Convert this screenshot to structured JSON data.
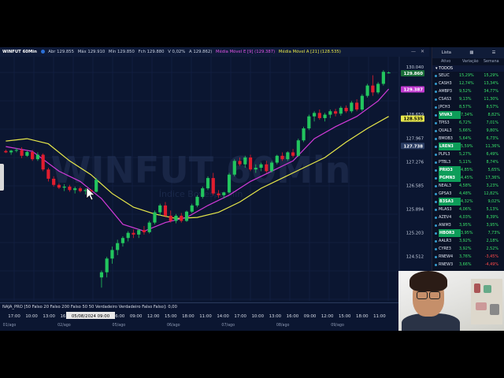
{
  "title_bar": {
    "symbol": "WINFUT 60Min",
    "abr": "Abr 129.855",
    "max": "Máx 129.910",
    "min": "Mín 129.850",
    "fech": "Fch 129.880",
    "var": "V 0,02%",
    "last": "A 129.862)",
    "ma9": "Média Móvel E [9] (129.387)",
    "ma21": "Média Móvel A [21] (128.535)"
  },
  "watermark": {
    "main": "WINFUT 60Min",
    "sub": "Índice Bovespa Min"
  },
  "indicator_bar": "NAJA_PRO [50 Falso 20 Falso 200 Falso 50 50 Verdadeiro Verdadeiro Falso Falso]: 0,00",
  "price_axis": {
    "labels": [
      "130.040",
      "128.659",
      "127.967",
      "127.276",
      "126.585",
      "125.894",
      "125.203",
      "124.512"
    ],
    "badges": [
      {
        "text": "129.860",
        "color": "#ffffff",
        "bg": "#1b6f3a"
      },
      {
        "text": "129.387",
        "color": "#ffffff",
        "bg": "#c13ad1"
      },
      {
        "text": "128.535",
        "color": "#000000",
        "bg": "#e6e64c"
      },
      {
        "text": "127.738",
        "color": "#ffffff",
        "bg": "#2b3d63"
      }
    ]
  },
  "time_axis": {
    "times": [
      "17:00",
      "10:00",
      "13:00",
      "16:00",
      "10:00",
      "13:00",
      "16:00",
      "09:00",
      "12:00",
      "15:00",
      "18:00",
      "11:00",
      "14:00",
      "17:00",
      "10:00",
      "13:00",
      "16:00",
      "09:00",
      "12:00",
      "15:00",
      "18:00",
      "11:00"
    ],
    "dates": [
      "01/ago",
      "02/ago",
      "05/ago",
      "06/ago",
      "07/ago",
      "08/ago",
      "09/ago"
    ],
    "cursor_label": "05/08/2024 09:00"
  },
  "watchlist": {
    "tabs": [
      "Lista",
      "Ativo",
      "Variação",
      "Semana"
    ],
    "group": "TODOS",
    "rows": [
      {
        "sym": "SELIC",
        "pct": "15,29%",
        "wk": "15,29%",
        "hl": false,
        "neg": false
      },
      {
        "sym": "CASH3",
        "pct": "12,74%",
        "wk": "13,34%",
        "hl": false,
        "neg": false
      },
      {
        "sym": "AMBP3",
        "pct": "9,52%",
        "wk": "34,77%",
        "hl": false,
        "neg": false
      },
      {
        "sym": "CSAS3",
        "pct": "9,13%",
        "wk": "11,30%",
        "hl": false,
        "neg": false
      },
      {
        "sym": "JPCH3",
        "pct": "8,57%",
        "wk": "8,57%",
        "hl": false,
        "neg": false
      },
      {
        "sym": "VIVA3",
        "pct": "7,34%",
        "wk": "8,82%",
        "hl": true,
        "neg": false
      },
      {
        "sym": "TPIS3",
        "pct": "6,72%",
        "wk": "7,01%",
        "hl": false,
        "neg": false
      },
      {
        "sym": "QUAL3",
        "pct": "5,66%",
        "wk": "9,80%",
        "hl": false,
        "neg": false
      },
      {
        "sym": "BMOB3",
        "pct": "5,64%",
        "wk": "6,73%",
        "hl": false,
        "neg": false
      },
      {
        "sym": "LREN3",
        "pct": "5,59%",
        "wk": "11,36%",
        "hl": true,
        "neg": false
      },
      {
        "sym": "PLPL3",
        "pct": "5,27%",
        "wk": "6,49%",
        "hl": false,
        "neg": false
      },
      {
        "sym": "PTBL3",
        "pct": "5,11%",
        "wk": "8,74%",
        "hl": false,
        "neg": false
      },
      {
        "sym": "PRIO3",
        "pct": "4,85%",
        "wk": "5,65%",
        "hl": true,
        "neg": false
      },
      {
        "sym": "PGMN3",
        "pct": "4,45%",
        "wk": "17,36%",
        "hl": true,
        "neg": false
      },
      {
        "sym": "NEAL3",
        "pct": "4,58%",
        "wk": "3,23%",
        "hl": false,
        "neg": false
      },
      {
        "sym": "GPSA3",
        "pct": "4,48%",
        "wk": "12,82%",
        "hl": false,
        "neg": false
      },
      {
        "sym": "B3SA3",
        "pct": "4,32%",
        "wk": "9,02%",
        "hl": true,
        "neg": false
      },
      {
        "sym": "MLAS3",
        "pct": "4,06%",
        "wk": "5,13%",
        "hl": false,
        "neg": false
      },
      {
        "sym": "AZEV4",
        "pct": "4,03%",
        "wk": "8,39%",
        "hl": false,
        "neg": false
      },
      {
        "sym": "ANIM3",
        "pct": "3,95%",
        "wk": "3,95%",
        "hl": false,
        "neg": false
      },
      {
        "sym": "HBOR3",
        "pct": "3,95%",
        "wk": "7,73%",
        "hl": true,
        "neg": false
      },
      {
        "sym": "AALR3",
        "pct": "3,92%",
        "wk": "2,18%",
        "hl": false,
        "neg": false
      },
      {
        "sym": "CYRE3",
        "pct": "3,92%",
        "wk": "2,52%",
        "hl": false,
        "neg": false
      },
      {
        "sym": "RNEW4",
        "pct": "3,76%",
        "wk": "-3,45%",
        "hl": false,
        "neg": true
      },
      {
        "sym": "RNEW3",
        "pct": "3,66%",
        "wk": "-4,49%",
        "hl": false,
        "neg": true
      }
    ]
  },
  "colors": {
    "up": "#22c55e",
    "down": "#e11d2e",
    "ma9": "#d13ad8",
    "ma21": "#e8e84a",
    "background": "#0b1631"
  },
  "chart_data": {
    "type": "candlestick",
    "candles": [
      {
        "o": 127.59,
        "h": 127.63,
        "l": 127.53,
        "c": 127.55
      },
      {
        "o": 127.55,
        "h": 127.62,
        "l": 127.48,
        "c": 127.6
      },
      {
        "o": 127.6,
        "h": 127.68,
        "l": 127.55,
        "c": 127.62
      },
      {
        "o": 127.62,
        "h": 127.7,
        "l": 127.38,
        "c": 127.45
      },
      {
        "o": 127.45,
        "h": 127.6,
        "l": 127.42,
        "c": 127.56
      },
      {
        "o": 127.56,
        "h": 127.62,
        "l": 127.3,
        "c": 127.35
      },
      {
        "o": 127.35,
        "h": 127.55,
        "l": 127.3,
        "c": 127.48
      },
      {
        "o": 127.48,
        "h": 127.52,
        "l": 127.0,
        "c": 127.05
      },
      {
        "o": 127.05,
        "h": 127.1,
        "l": 126.7,
        "c": 126.78
      },
      {
        "o": 126.78,
        "h": 126.85,
        "l": 126.55,
        "c": 126.6
      },
      {
        "o": 126.6,
        "h": 126.65,
        "l": 126.48,
        "c": 126.52
      },
      {
        "o": 126.52,
        "h": 126.62,
        "l": 126.42,
        "c": 126.55
      },
      {
        "o": 126.55,
        "h": 126.6,
        "l": 126.4,
        "c": 126.45
      },
      {
        "o": 126.45,
        "h": 126.55,
        "l": 126.35,
        "c": 126.5
      },
      {
        "o": 126.5,
        "h": 126.55,
        "l": 126.38,
        "c": 126.42
      },
      {
        "o": 126.42,
        "h": 126.5,
        "l": 126.32,
        "c": 126.45
      },
      {
        "o": 126.45,
        "h": 126.48,
        "l": 126.35,
        "c": 126.4
      },
      {
        "o": 126.4,
        "h": 126.8,
        "l": 126.38,
        "c": 126.75
      },
      {
        "o": 123.9,
        "h": 124.1,
        "l": 123.6,
        "c": 124.05
      },
      {
        "o": 124.05,
        "h": 124.5,
        "l": 123.9,
        "c": 124.45
      },
      {
        "o": 124.45,
        "h": 124.8,
        "l": 124.3,
        "c": 124.7
      },
      {
        "o": 124.7,
        "h": 125.0,
        "l": 124.55,
        "c": 124.9
      },
      {
        "o": 124.9,
        "h": 125.1,
        "l": 124.8,
        "c": 125.05
      },
      {
        "o": 125.05,
        "h": 125.25,
        "l": 124.95,
        "c": 125.2
      },
      {
        "o": 125.2,
        "h": 125.3,
        "l": 125.05,
        "c": 125.15
      },
      {
        "o": 125.15,
        "h": 125.32,
        "l": 125.05,
        "c": 125.28
      },
      {
        "o": 125.28,
        "h": 125.4,
        "l": 125.15,
        "c": 125.22
      },
      {
        "o": 125.22,
        "h": 125.55,
        "l": 125.18,
        "c": 125.5
      },
      {
        "o": 125.5,
        "h": 125.85,
        "l": 125.45,
        "c": 125.8
      },
      {
        "o": 125.8,
        "h": 126.05,
        "l": 125.7,
        "c": 126.0
      },
      {
        "o": 126.0,
        "h": 126.1,
        "l": 125.65,
        "c": 125.7
      },
      {
        "o": 125.7,
        "h": 125.85,
        "l": 125.5,
        "c": 125.55
      },
      {
        "o": 125.55,
        "h": 125.75,
        "l": 125.48,
        "c": 125.7
      },
      {
        "o": 125.7,
        "h": 125.78,
        "l": 125.5,
        "c": 125.55
      },
      {
        "o": 125.55,
        "h": 125.85,
        "l": 125.52,
        "c": 125.82
      },
      {
        "o": 125.82,
        "h": 126.05,
        "l": 125.78,
        "c": 126.0
      },
      {
        "o": 126.0,
        "h": 126.3,
        "l": 125.95,
        "c": 126.25
      },
      {
        "o": 126.25,
        "h": 126.55,
        "l": 126.2,
        "c": 126.5
      },
      {
        "o": 126.5,
        "h": 126.85,
        "l": 126.45,
        "c": 126.8
      },
      {
        "o": 126.8,
        "h": 126.95,
        "l": 126.3,
        "c": 126.35
      },
      {
        "o": 126.35,
        "h": 126.45,
        "l": 126.22,
        "c": 126.3
      },
      {
        "o": 126.3,
        "h": 126.4,
        "l": 126.2,
        "c": 126.38
      },
      {
        "o": 126.38,
        "h": 126.95,
        "l": 126.35,
        "c": 126.9
      },
      {
        "o": 126.9,
        "h": 127.35,
        "l": 126.85,
        "c": 127.3
      },
      {
        "o": 127.3,
        "h": 127.4,
        "l": 127.15,
        "c": 127.2
      },
      {
        "o": 127.2,
        "h": 127.45,
        "l": 127.1,
        "c": 127.4
      },
      {
        "o": 127.4,
        "h": 127.48,
        "l": 127.0,
        "c": 127.05
      },
      {
        "o": 127.05,
        "h": 127.2,
        "l": 126.95,
        "c": 127.1
      },
      {
        "o": 127.1,
        "h": 127.25,
        "l": 127.0,
        "c": 127.2
      },
      {
        "o": 127.2,
        "h": 127.3,
        "l": 126.95,
        "c": 127.0
      },
      {
        "o": 127.0,
        "h": 127.3,
        "l": 126.96,
        "c": 127.25
      },
      {
        "o": 127.25,
        "h": 127.48,
        "l": 127.2,
        "c": 127.45
      },
      {
        "o": 127.45,
        "h": 127.55,
        "l": 127.3,
        "c": 127.35
      },
      {
        "o": 127.35,
        "h": 127.58,
        "l": 127.3,
        "c": 127.55
      },
      {
        "o": 127.55,
        "h": 127.65,
        "l": 127.4,
        "c": 127.45
      },
      {
        "o": 127.45,
        "h": 127.95,
        "l": 127.42,
        "c": 127.9
      },
      {
        "o": 127.9,
        "h": 128.3,
        "l": 127.85,
        "c": 128.25
      },
      {
        "o": 128.25,
        "h": 128.65,
        "l": 128.2,
        "c": 128.6
      },
      {
        "o": 128.6,
        "h": 128.75,
        "l": 128.45,
        "c": 128.7
      },
      {
        "o": 128.7,
        "h": 128.8,
        "l": 128.5,
        "c": 128.55
      },
      {
        "o": 128.55,
        "h": 128.7,
        "l": 128.45,
        "c": 128.65
      },
      {
        "o": 128.65,
        "h": 128.8,
        "l": 128.55,
        "c": 128.75
      },
      {
        "o": 128.75,
        "h": 128.82,
        "l": 128.6,
        "c": 128.68
      },
      {
        "o": 128.68,
        "h": 128.9,
        "l": 128.62,
        "c": 128.85
      },
      {
        "o": 128.85,
        "h": 128.92,
        "l": 128.7,
        "c": 128.75
      },
      {
        "o": 128.75,
        "h": 129.05,
        "l": 128.7,
        "c": 129.0
      },
      {
        "o": 129.0,
        "h": 129.1,
        "l": 128.75,
        "c": 128.8
      },
      {
        "o": 128.8,
        "h": 129.25,
        "l": 128.75,
        "c": 129.2
      },
      {
        "o": 129.2,
        "h": 129.55,
        "l": 129.15,
        "c": 129.5
      },
      {
        "o": 129.5,
        "h": 129.8,
        "l": 129.2,
        "c": 129.3
      },
      {
        "o": 129.3,
        "h": 129.6,
        "l": 129.25,
        "c": 129.55
      },
      {
        "o": 129.55,
        "h": 129.95,
        "l": 129.5,
        "c": 129.9
      },
      {
        "o": 129.88,
        "h": 129.91,
        "l": 129.85,
        "c": 129.88
      }
    ],
    "ema9": [
      [
        0,
        127.72
      ],
      [
        5,
        127.58
      ],
      [
        10,
        127.0
      ],
      [
        14,
        126.7
      ],
      [
        18,
        126.2
      ],
      [
        22,
        125.45
      ],
      [
        26,
        125.25
      ],
      [
        30,
        125.5
      ],
      [
        34,
        125.65
      ],
      [
        38,
        126.0
      ],
      [
        42,
        126.3
      ],
      [
        46,
        126.7
      ],
      [
        50,
        127.0
      ],
      [
        54,
        127.3
      ],
      [
        58,
        127.95
      ],
      [
        62,
        128.3
      ],
      [
        66,
        128.6
      ],
      [
        70,
        129.05
      ],
      [
        72,
        129.4
      ]
    ],
    "sma21": [
      [
        0,
        127.88
      ],
      [
        4,
        127.95
      ],
      [
        8,
        127.8
      ],
      [
        12,
        127.3
      ],
      [
        16,
        126.9
      ],
      [
        20,
        126.35
      ],
      [
        24,
        125.95
      ],
      [
        28,
        125.75
      ],
      [
        32,
        125.62
      ],
      [
        36,
        125.65
      ],
      [
        40,
        125.8
      ],
      [
        44,
        126.1
      ],
      [
        48,
        126.5
      ],
      [
        52,
        126.8
      ],
      [
        56,
        127.1
      ],
      [
        60,
        127.4
      ],
      [
        64,
        127.85
      ],
      [
        68,
        128.25
      ],
      [
        72,
        128.6
      ]
    ],
    "ylim": [
      123.4,
      130.25
    ]
  }
}
